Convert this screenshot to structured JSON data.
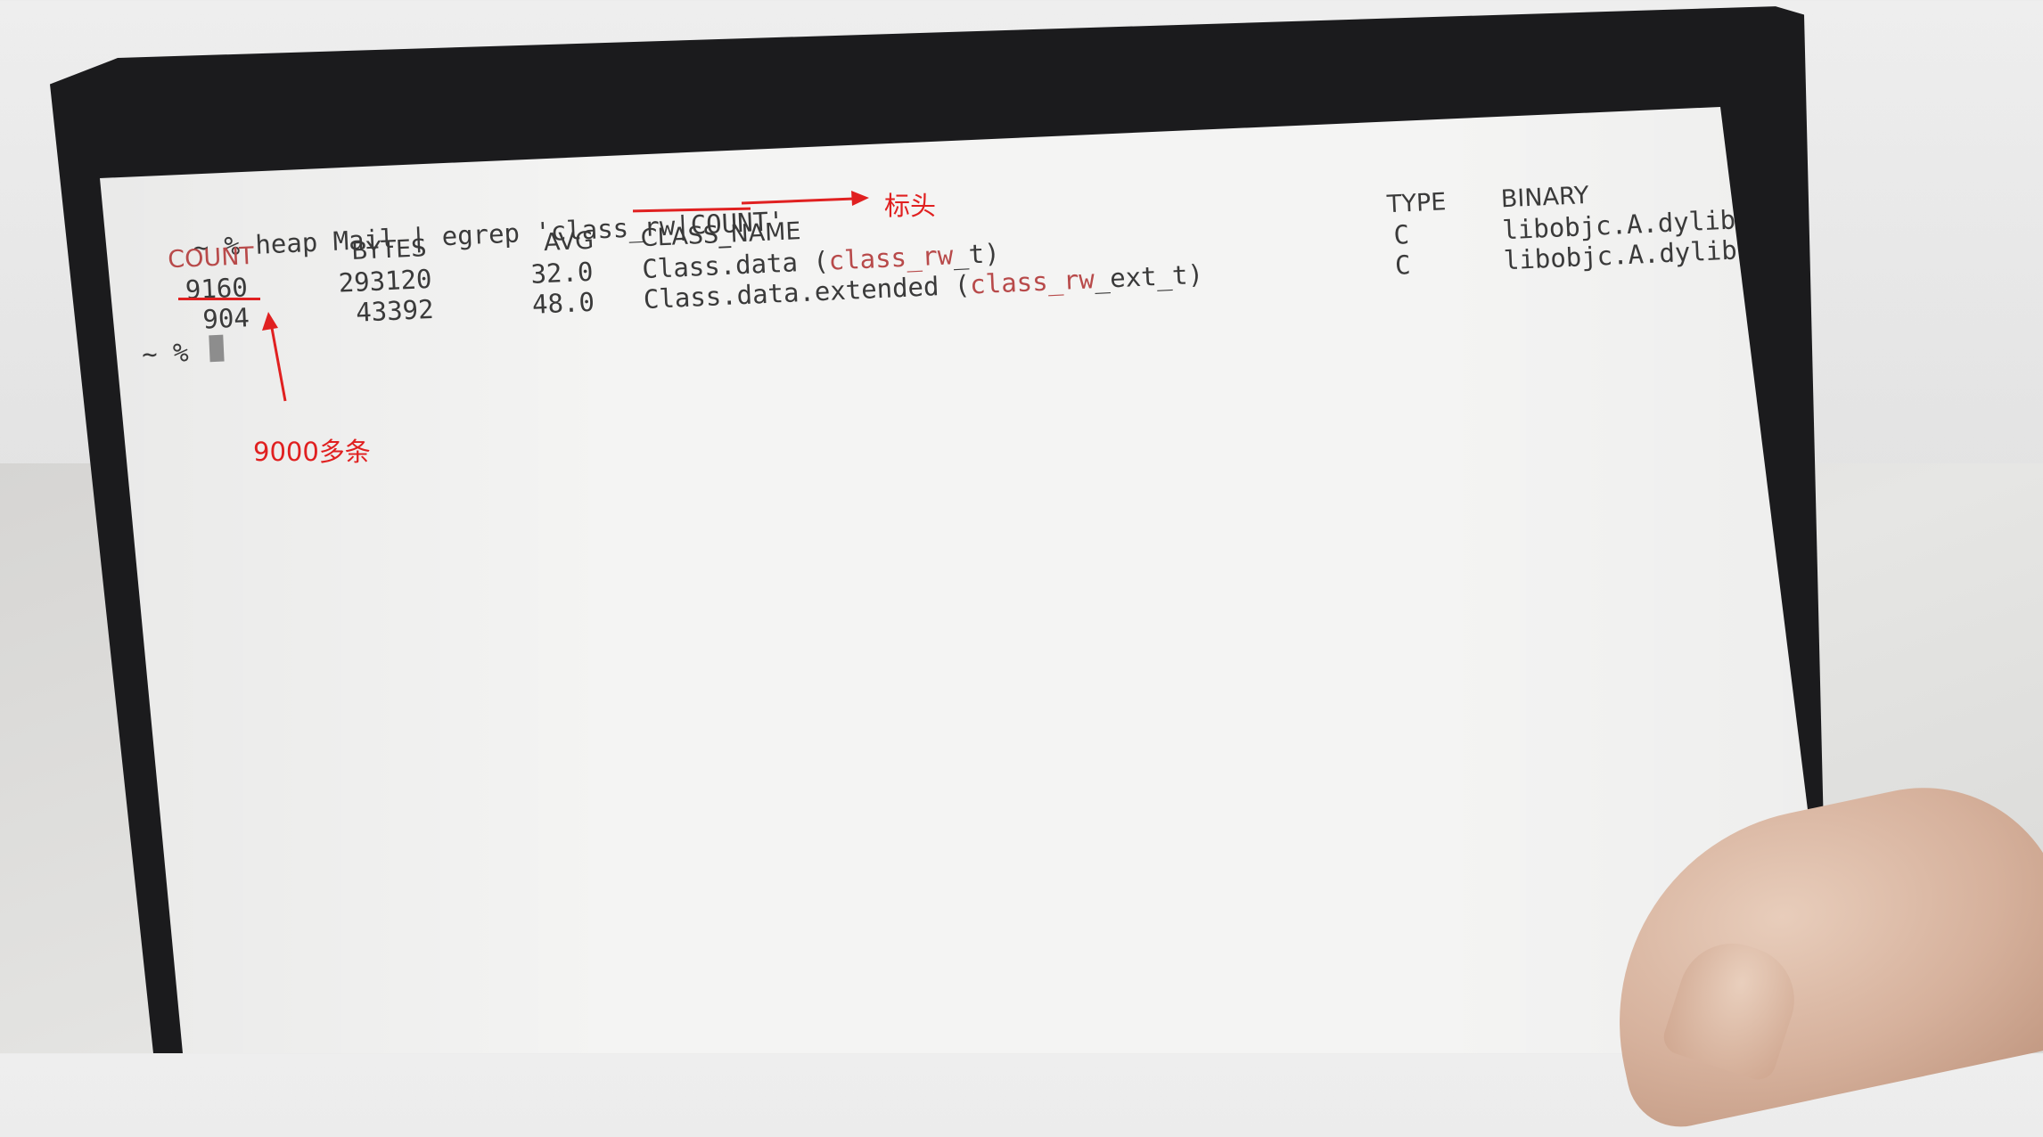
{
  "terminal": {
    "command_prompt": "~ %",
    "command_pre": " heap Mail | egrep 'class_rw",
    "command_hl": "|COUNT'",
    "headers": {
      "count": "COUNT",
      "bytes": "BYTES",
      "avg": "AVG",
      "class_name": "CLASS_NAME",
      "type": "TYPE",
      "binary": "BINARY"
    },
    "rows": [
      {
        "count": "9160",
        "bytes": "293120",
        "avg": "32.0",
        "class_pre": "Class.data (",
        "class_hl": "class_rw",
        "class_post": "_t)",
        "type": "C",
        "binary": "libobjc.A.dylib"
      },
      {
        "count": "904",
        "bytes": "43392",
        "avg": "48.0",
        "class_pre": "Class.data.extended (",
        "class_hl": "class_rw",
        "class_post": "_ext_t)",
        "type": "C",
        "binary": "libobjc.A.dylib"
      }
    ],
    "final_prompt": "~ %"
  },
  "annotations": {
    "header_note": "标头",
    "count_note": "9000多条",
    "color": "#e02020"
  },
  "colors": {
    "highlight": "#b84a4a",
    "screen": "#f4f4f3",
    "bezel": "#1b1b1d"
  }
}
